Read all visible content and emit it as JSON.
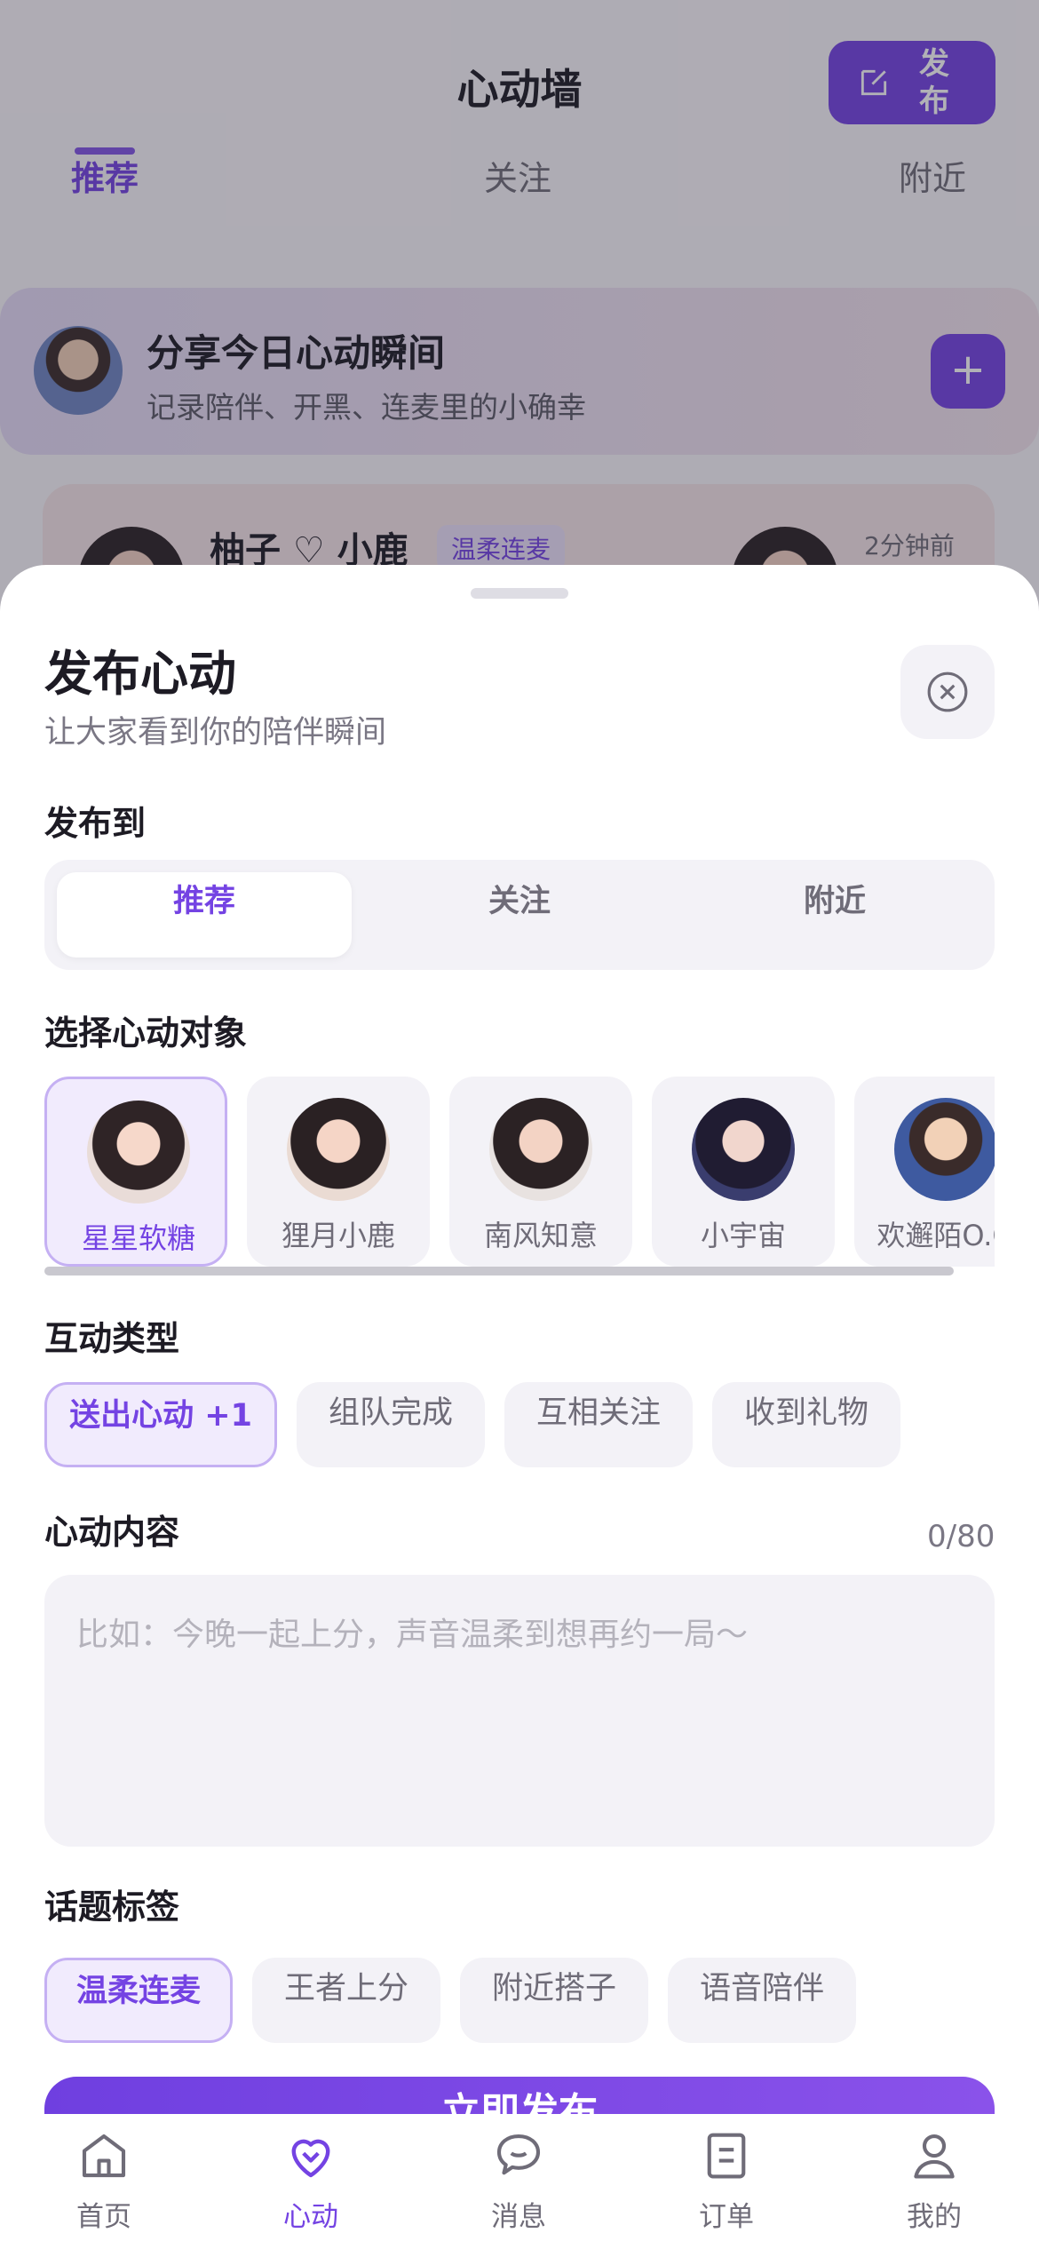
{
  "header": {
    "title": "心动墙",
    "publish_label": "发布",
    "tabs": [
      "推荐",
      "关注",
      "附近"
    ]
  },
  "share_card": {
    "title": "分享今日心动瞬间",
    "subtitle": "记录陪伴、开黑、连麦里的小确幸",
    "plus": "+"
  },
  "post_preview": {
    "names": "柚子 ♡ 小鹿",
    "tag": "温柔连麦",
    "time": "2分钟前"
  },
  "sheet": {
    "title": "发布心动",
    "subtitle": "让大家看到你的陪伴瞬间",
    "publish_to_label": "发布到",
    "publish_to_options": [
      "推荐",
      "关注",
      "附近"
    ],
    "publish_to_selected": "推荐",
    "target_label": "选择心动对象",
    "targets": [
      "星星软糖",
      "狸月小鹿",
      "南风知意",
      "小宇宙",
      "欢邂陌O.O"
    ],
    "target_selected": "星星软糖",
    "interaction_label": "互动类型",
    "interactions": [
      "送出心动 +1",
      "组队完成",
      "互相关注",
      "收到礼物"
    ],
    "interaction_selected": "送出心动 +1",
    "content_label": "心动内容",
    "content_counter": "0/80",
    "content_placeholder": "比如：今晚一起上分，声音温柔到想再约一局～",
    "content_value": "",
    "topic_label": "话题标签",
    "topics": [
      "温柔连麦",
      "王者上分",
      "附近搭子",
      "语音陪伴"
    ],
    "topic_selected": "温柔连麦",
    "submit_label": "立即发布"
  },
  "bottom_nav": {
    "items": [
      {
        "label": "首页",
        "icon": "home-icon"
      },
      {
        "label": "心动",
        "icon": "heart-icon"
      },
      {
        "label": "消息",
        "icon": "message-icon"
      },
      {
        "label": "订单",
        "icon": "order-icon"
      },
      {
        "label": "我的",
        "icon": "profile-icon"
      }
    ],
    "active": "心动"
  },
  "colors": {
    "accent": "#7443e3",
    "chip_bg": "#f3f2f7",
    "chip_active_bg": "#f1ebfd",
    "text_primary": "#1d1b24",
    "text_muted": "#6f6c78"
  }
}
